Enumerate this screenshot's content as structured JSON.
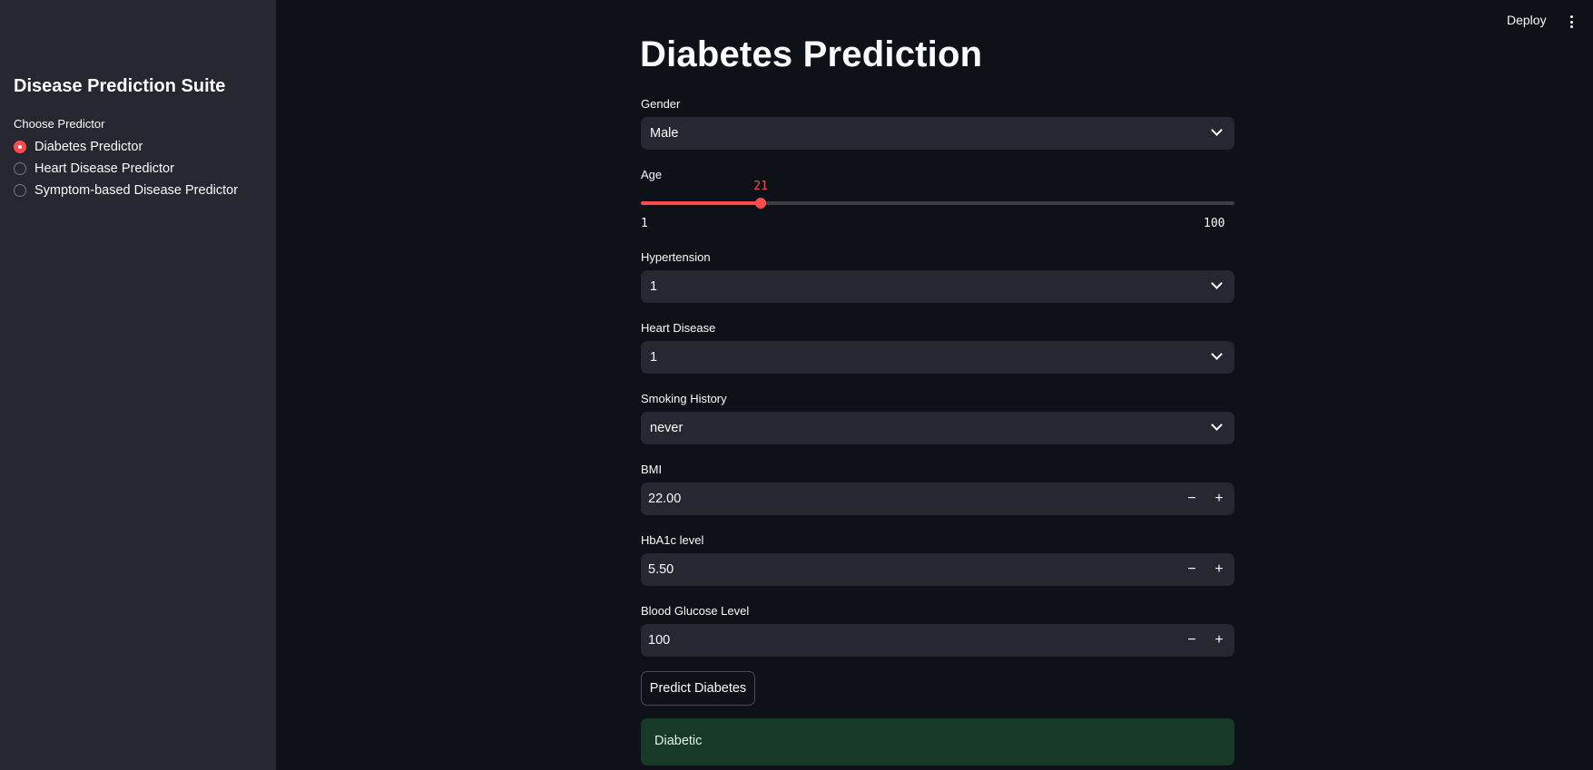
{
  "topbar": {
    "deploy_label": "Deploy",
    "menu_icon": "kebab-menu-icon"
  },
  "sidebar": {
    "title": "Disease Prediction Suite",
    "radio_label": "Choose Predictor",
    "options": [
      {
        "label": "Diabetes Predictor",
        "checked": true
      },
      {
        "label": "Heart Disease Predictor",
        "checked": false
      },
      {
        "label": "Symptom-based Disease Predictor",
        "checked": false
      }
    ]
  },
  "main": {
    "title": "Diabetes Prediction",
    "gender": {
      "label": "Gender",
      "value": "Male"
    },
    "age": {
      "label": "Age",
      "value": 21,
      "min": 1,
      "max": 100
    },
    "hypertension": {
      "label": "Hypertension",
      "value": "1"
    },
    "heart_disease": {
      "label": "Heart Disease",
      "value": "1"
    },
    "smoking_history": {
      "label": "Smoking History",
      "value": "never"
    },
    "bmi": {
      "label": "BMI",
      "value": "22.00"
    },
    "hba1c": {
      "label": "HbA1c level",
      "value": "5.50"
    },
    "blood_glucose": {
      "label": "Blood Glucose Level",
      "value": "100"
    },
    "stepper": {
      "minus": "−",
      "plus": "+"
    },
    "predict_button": "Predict Diabetes",
    "result": "Diabetic"
  },
  "colors": {
    "accent": "#ff4b4b",
    "background": "#0e1117",
    "sidebar": "#262730",
    "success_bg": "#173928"
  }
}
